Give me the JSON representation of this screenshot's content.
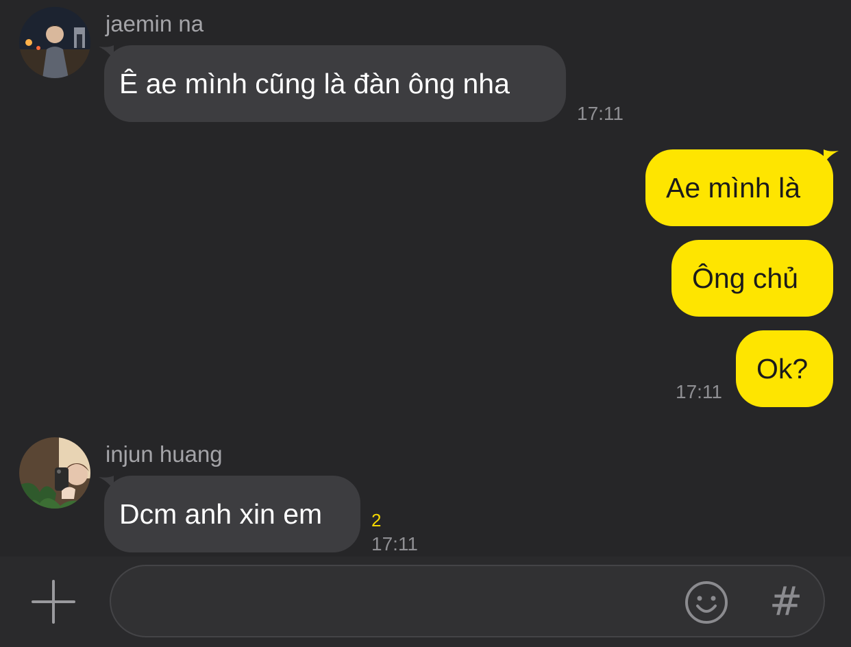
{
  "messages": [
    {
      "sender": "jaemin na",
      "text": "Ê ae mình cũng là đàn ông nha",
      "time": "17:11"
    },
    {
      "text": "Ae mình là"
    },
    {
      "text": "Ông chủ"
    },
    {
      "text": "Ok?",
      "time": "17:11"
    },
    {
      "sender": "injun huang",
      "text": "Dcm anh xin em",
      "unread": "2",
      "time": "17:11"
    }
  ],
  "composer": {
    "plus_icon": "plus-icon",
    "emoji_icon": "smiley-icon",
    "hash_label": "#"
  },
  "colors": {
    "background": "#262628",
    "incoming_bubble": "#3d3d40",
    "outgoing_bubble": "#fee500",
    "unread": "#f5d800"
  }
}
